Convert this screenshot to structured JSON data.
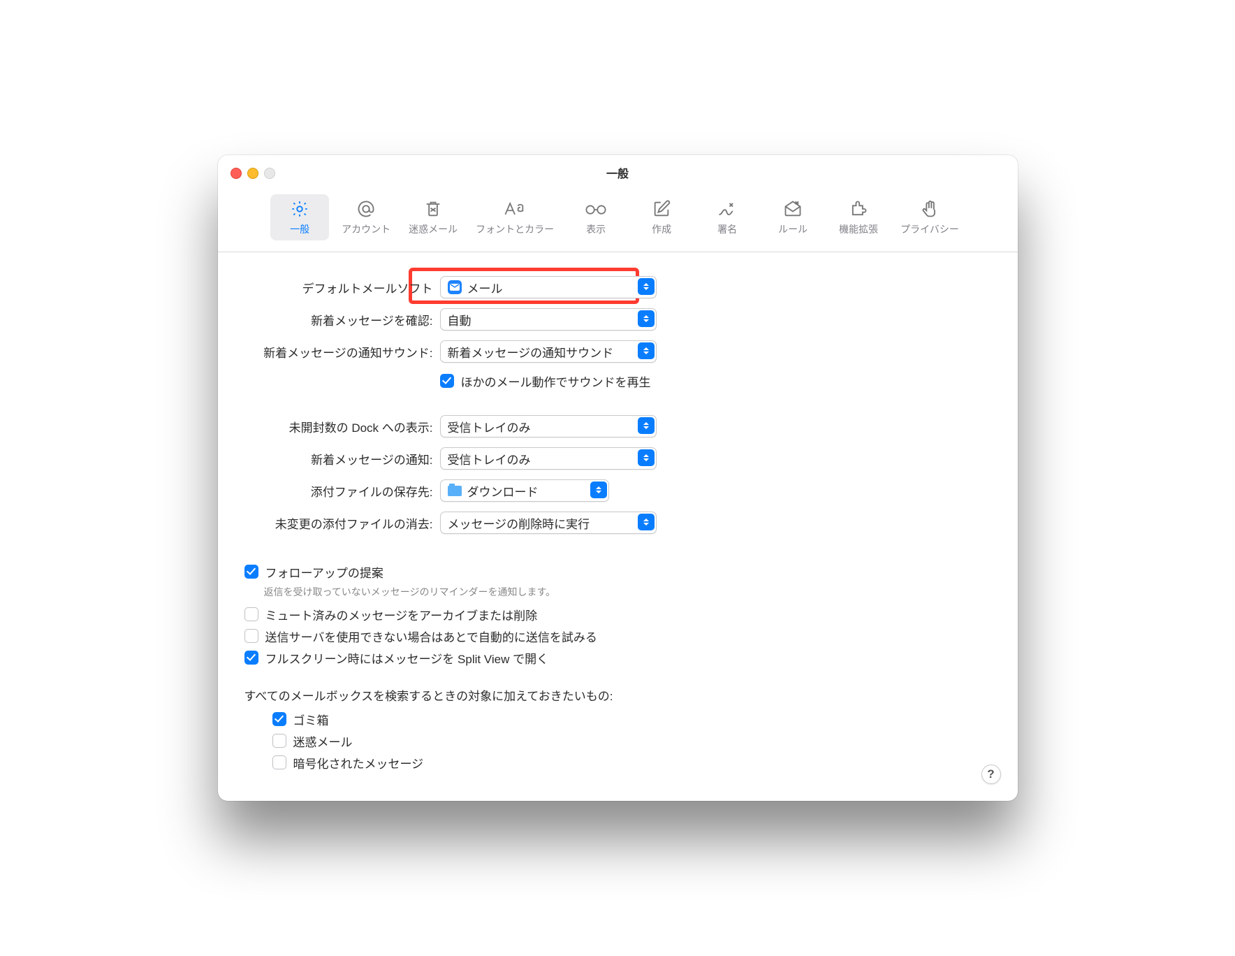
{
  "window": {
    "title": "一般"
  },
  "toolbar": [
    {
      "id": "general",
      "label": "一般"
    },
    {
      "id": "accounts",
      "label": "アカウント"
    },
    {
      "id": "junk",
      "label": "迷惑メール"
    },
    {
      "id": "fonts",
      "label": "フォントとカラー"
    },
    {
      "id": "viewing",
      "label": "表示"
    },
    {
      "id": "composing",
      "label": "作成"
    },
    {
      "id": "signatures",
      "label": "署名"
    },
    {
      "id": "rules",
      "label": "ルール"
    },
    {
      "id": "extensions",
      "label": "機能拡張"
    },
    {
      "id": "privacy",
      "label": "プライバシー"
    }
  ],
  "form": {
    "default_app": {
      "label": "デフォルトメールソフト",
      "value": "メール",
      "icon_bg": "#1d83ff"
    },
    "check_new": {
      "label": "新着メッセージを確認:",
      "value": "自動"
    },
    "sound": {
      "label": "新着メッセージの通知サウンド:",
      "value": "新着メッセージの通知サウンド"
    },
    "play_other_sounds": {
      "label": "ほかのメール動作でサウンドを再生",
      "checked": true
    },
    "dock_unread": {
      "label": "未開封数の Dock への表示:",
      "value": "受信トレイのみ"
    },
    "notify_new": {
      "label": "新着メッセージの通知:",
      "value": "受信トレイのみ"
    },
    "downloads": {
      "label": "添付ファイルの保存先:",
      "value": "ダウンロード",
      "folder_bg": "#3da9ff"
    },
    "remove_attach": {
      "label": "未変更の添付ファイルの消去:",
      "value": "メッセージの削除時に実行"
    }
  },
  "options": {
    "followup": {
      "label": "フォローアップの提案",
      "sub": "返信を受け取っていないメッセージのリマインダーを通知します。",
      "checked": true
    },
    "archive_muted": {
      "label": "ミュート済みのメッセージをアーカイブまたは削除",
      "checked": false
    },
    "retry_send": {
      "label": "送信サーバを使用できない場合はあとで自動的に送信を試みる",
      "checked": false
    },
    "split_view": {
      "label": "フルスクリーン時にはメッセージを Split View で開く",
      "checked": true
    }
  },
  "search": {
    "heading": "すべてのメールボックスを検索するときの対象に加えておきたいもの:",
    "trash": {
      "label": "ゴミ箱",
      "checked": true
    },
    "junk": {
      "label": "迷惑メール",
      "checked": false
    },
    "encrypted": {
      "label": "暗号化されたメッセージ",
      "checked": false
    }
  },
  "help": "?"
}
